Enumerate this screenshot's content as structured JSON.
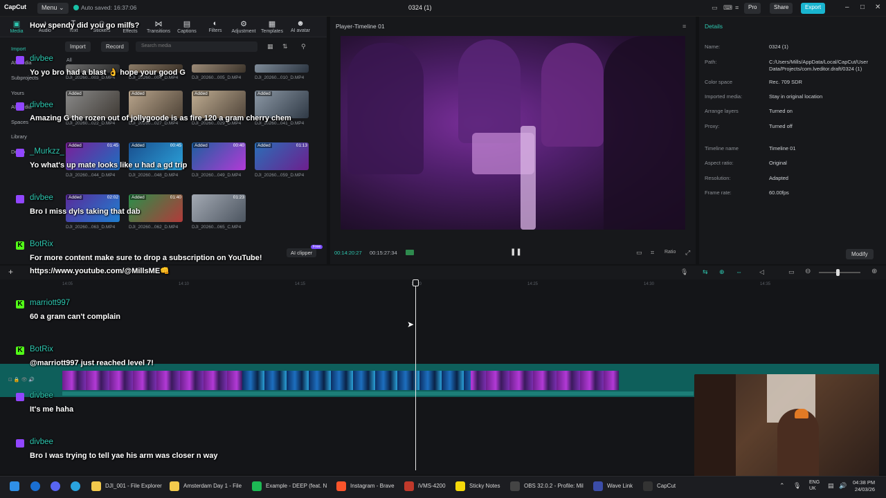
{
  "app": {
    "logo": "CapCut",
    "menu_label": "Menu ⌄",
    "autosave": "Auto saved: 16:37:06",
    "project_title": "0324 (1)",
    "pro_label": "Pro",
    "share_label": "Share",
    "export_label": "Export"
  },
  "toolbar": [
    {
      "label": "Media",
      "icon": "media-icon"
    },
    {
      "label": "Audio",
      "icon": "audio-icon"
    },
    {
      "label": "Text",
      "icon": "text-icon"
    },
    {
      "label": "Stickers",
      "icon": "stickers-icon"
    },
    {
      "label": "Effects",
      "icon": "effects-icon"
    },
    {
      "label": "Transitions",
      "icon": "transitions-icon"
    },
    {
      "label": "Captions",
      "icon": "captions-icon"
    },
    {
      "label": "Filters",
      "icon": "filters-icon"
    },
    {
      "label": "Adjustment",
      "icon": "adjustment-icon"
    },
    {
      "label": "Templates",
      "icon": "templates-icon"
    },
    {
      "label": "AI avatar",
      "icon": "ai-avatar-icon"
    }
  ],
  "leftnav": [
    "Import",
    "AI media",
    "Subprojects",
    "Yours",
    "AI media",
    "Spaces",
    "Library",
    "Demo"
  ],
  "media": {
    "import_label": "Import",
    "record_label": "Record",
    "search_placeholder": "Search media",
    "filter_all": "All",
    "ai_clipper": "AI clipper",
    "free_badge": "Free"
  },
  "thumbs": [
    {
      "tag": "",
      "dur": "",
      "name": "DJI_20260...003_D.MP4"
    },
    {
      "tag": "",
      "dur": "",
      "name": "DJI_20260...004_D.MP4"
    },
    {
      "tag": "",
      "dur": "",
      "name": "DJI_20260...005_D.MP4"
    },
    {
      "tag": "",
      "dur": "",
      "name": "DJI_20260...010_D.MP4"
    },
    {
      "tag": "Added",
      "dur": "",
      "name": "DJI_20260...022_D.MP4"
    },
    {
      "tag": "Added",
      "dur": "",
      "name": "DJI_20260...027_D.MP4"
    },
    {
      "tag": "Added",
      "dur": "",
      "name": "DJI_20260...029_D.MP4"
    },
    {
      "tag": "Added",
      "dur": "",
      "name": "DJI_20260...041_D.MP4"
    },
    {
      "tag": "Added",
      "dur": "01:45",
      "name": "DJI_20260...044_D.MP4"
    },
    {
      "tag": "Added",
      "dur": "00:45",
      "name": "DJI_20260...048_D.MP4"
    },
    {
      "tag": "Added",
      "dur": "00:40",
      "name": "DJI_20260...049_D.MP4"
    },
    {
      "tag": "Added",
      "dur": "01:13",
      "name": "DJI_20260...059_D.MP4"
    },
    {
      "tag": "Added",
      "dur": "02:02",
      "name": "DJI_20260...063_D.MP4"
    },
    {
      "tag": "Added",
      "dur": "01:40",
      "name": "DJI_20260...062_D.MP4"
    },
    {
      "tag": "",
      "dur": "01:23",
      "name": "DJI_20260...065_C.MP4"
    }
  ],
  "player": {
    "title": "Player-Timeline 01",
    "current_time": "00:14:20:27",
    "total_time": "00:15:27:34",
    "ratio_label": "Ratio"
  },
  "details": {
    "header": "Details",
    "rows": [
      {
        "label": "Name:",
        "value": "0324 (1)"
      },
      {
        "label": "Path:",
        "value": "C:/Users/Mills/AppData/Local/CapCut/User Data/Projects/com.lveditor.draft/0324 (1)"
      },
      {
        "label": "Color space",
        "value": "Rec. 709 SDR"
      },
      {
        "label": "Imported media:",
        "value": "Stay in original location"
      },
      {
        "label": "Arrange layers",
        "value": "Turned on"
      },
      {
        "label": "Proxy:",
        "value": "Turned off"
      },
      {
        "label": "Timeline name",
        "value": "Timeline 01"
      },
      {
        "label": "Aspect ratio:",
        "value": "Original"
      },
      {
        "label": "Resolution:",
        "value": "Adapted"
      },
      {
        "label": "Frame rate:",
        "value": "60.00fps"
      }
    ],
    "modify_label": "Modify"
  },
  "ruler_ticks": [
    "14:05",
    "14:10",
    "14:15",
    "14:20",
    "14:25",
    "14:30",
    "14:35"
  ],
  "chat": [
    {
      "platform": "twitch",
      "user": "",
      "msg": "How spendy did you go mills?"
    },
    {
      "platform": "twitch",
      "user": "divbee",
      "msg": "Yo yo bro had a blast 👌 hope your good G"
    },
    {
      "platform": "twitch",
      "user": "divbee",
      "msg": "Amazing G the rozen out of jollygoode is as fire 120 a gram cherry chem"
    },
    {
      "platform": "twitch",
      "user": "_Murkzz_",
      "msg": "Yo what's up mate looks like u had a gd trip"
    },
    {
      "platform": "twitch",
      "user": "divbee",
      "msg": "Bro I miss dyls taking that dab"
    },
    {
      "platform": "kick",
      "user": "BotRix",
      "msg": "For more content make sure to drop a subscription on YouTube!"
    },
    {
      "platform": "none",
      "user": "",
      "msg": "https://www.youtube.com/@MillsME👊"
    },
    {
      "platform": "kick",
      "user": "marriott997",
      "msg": "60 a gram can't complain"
    },
    {
      "platform": "kick",
      "user": "BotRix",
      "msg": "@marriott997 just reached level 7!"
    },
    {
      "platform": "twitch",
      "user": "divbee",
      "msg": "It's me haha"
    },
    {
      "platform": "twitch",
      "user": "divbee",
      "msg": "Bro I was trying to tell yae his arm was closer n way"
    }
  ],
  "taskbar": {
    "apps": [
      "DJI_001 - File Explorer",
      "Amsterdam Day 1 - File",
      "Example - DEEP (feat. N",
      "Instagram - Brave",
      "iVMS-4200",
      "Sticky Notes",
      "OBS 32.0.2 - Profile: Mil",
      "Wave Link",
      "CapCut"
    ],
    "lang": "ENG",
    "region": "UK",
    "time": "04:38 PM",
    "date": "24/03/26"
  }
}
